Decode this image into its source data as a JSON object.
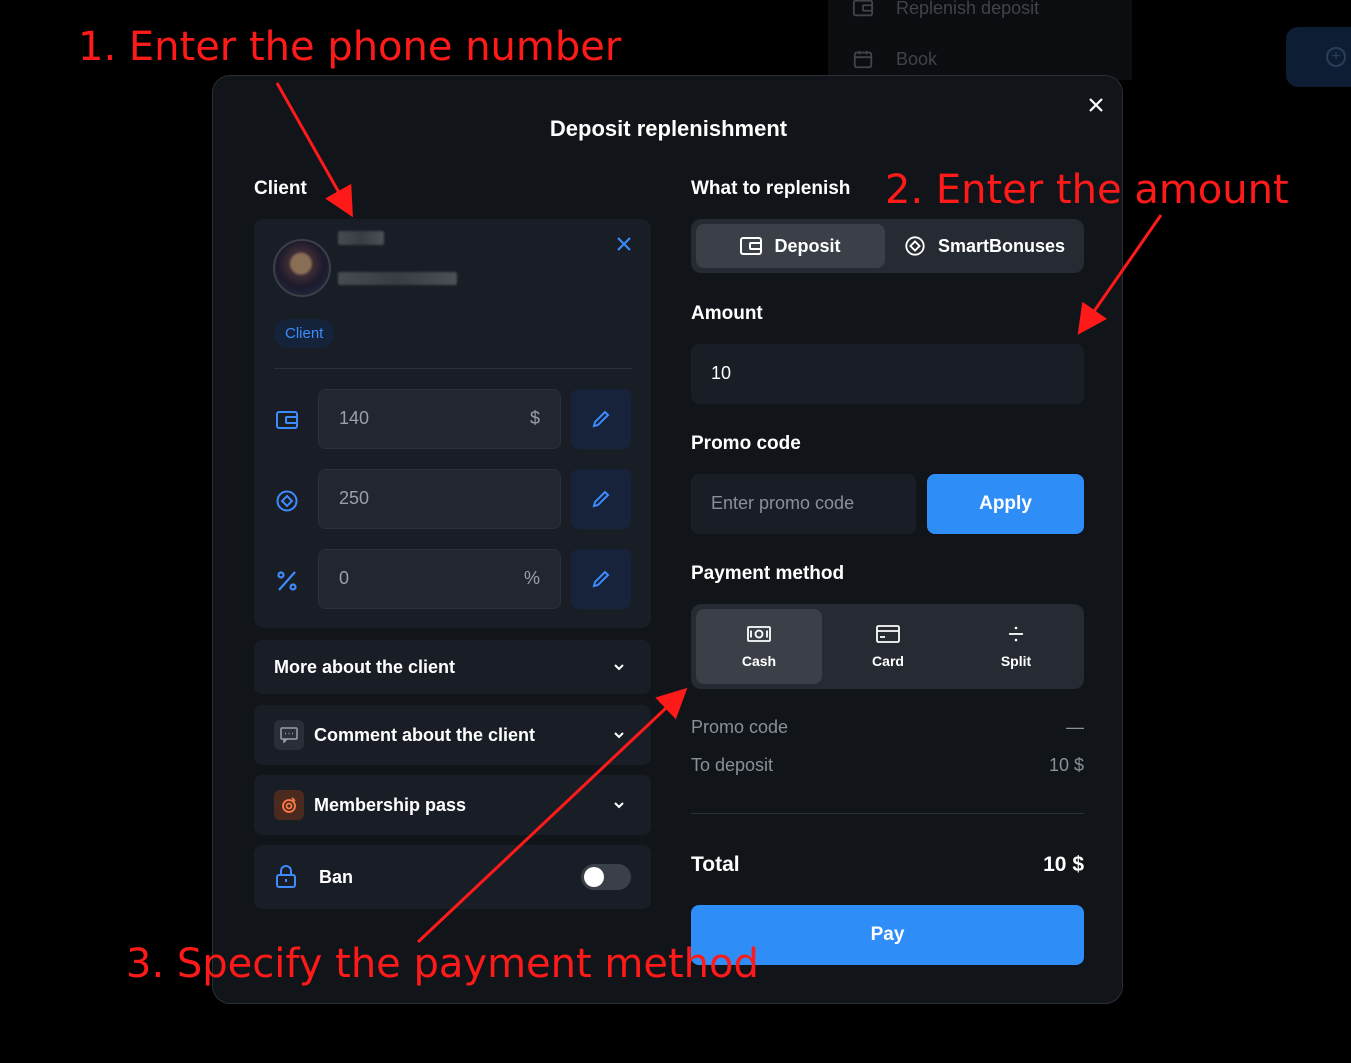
{
  "background": {
    "menu_items": [
      "Replenish deposit",
      "Book"
    ]
  },
  "modal": {
    "title": "Deposit replenishment",
    "client": {
      "label": "Client",
      "badge": "Client",
      "balances": [
        {
          "icon": "wallet-icon",
          "value": "140",
          "unit": "$"
        },
        {
          "icon": "bonus-icon",
          "value": "250",
          "unit": ""
        },
        {
          "icon": "percent-icon",
          "value": "0",
          "unit": "%"
        }
      ],
      "more_about": "More about the client",
      "comment": "Comment about the client",
      "membership": "Membership pass",
      "ban": "Ban",
      "ban_enabled": false
    },
    "replenish": {
      "label": "What to replenish",
      "options": [
        "Deposit",
        "SmartBonuses"
      ],
      "selected": "Deposit"
    },
    "amount": {
      "label": "Amount",
      "value": "10"
    },
    "promo": {
      "label": "Promo code",
      "placeholder": "Enter promo code",
      "apply": "Apply"
    },
    "payment": {
      "label": "Payment method",
      "options": [
        "Cash",
        "Card",
        "Split"
      ],
      "selected": "Cash"
    },
    "summary": {
      "promo_label": "Promo code",
      "promo_value": "—",
      "deposit_label": "To deposit",
      "deposit_value": "10 $",
      "total_label": "Total",
      "total_value": "10 $"
    },
    "pay": "Pay"
  },
  "annotations": {
    "step1": "1. Enter the phone number",
    "step2": "2. Enter the amount",
    "step3": "3. Specify the payment method",
    "color": "#ff1a1a"
  },
  "colors": {
    "accent": "#2f8df7",
    "background": "#111419",
    "annotation": "#ff1a1a"
  }
}
